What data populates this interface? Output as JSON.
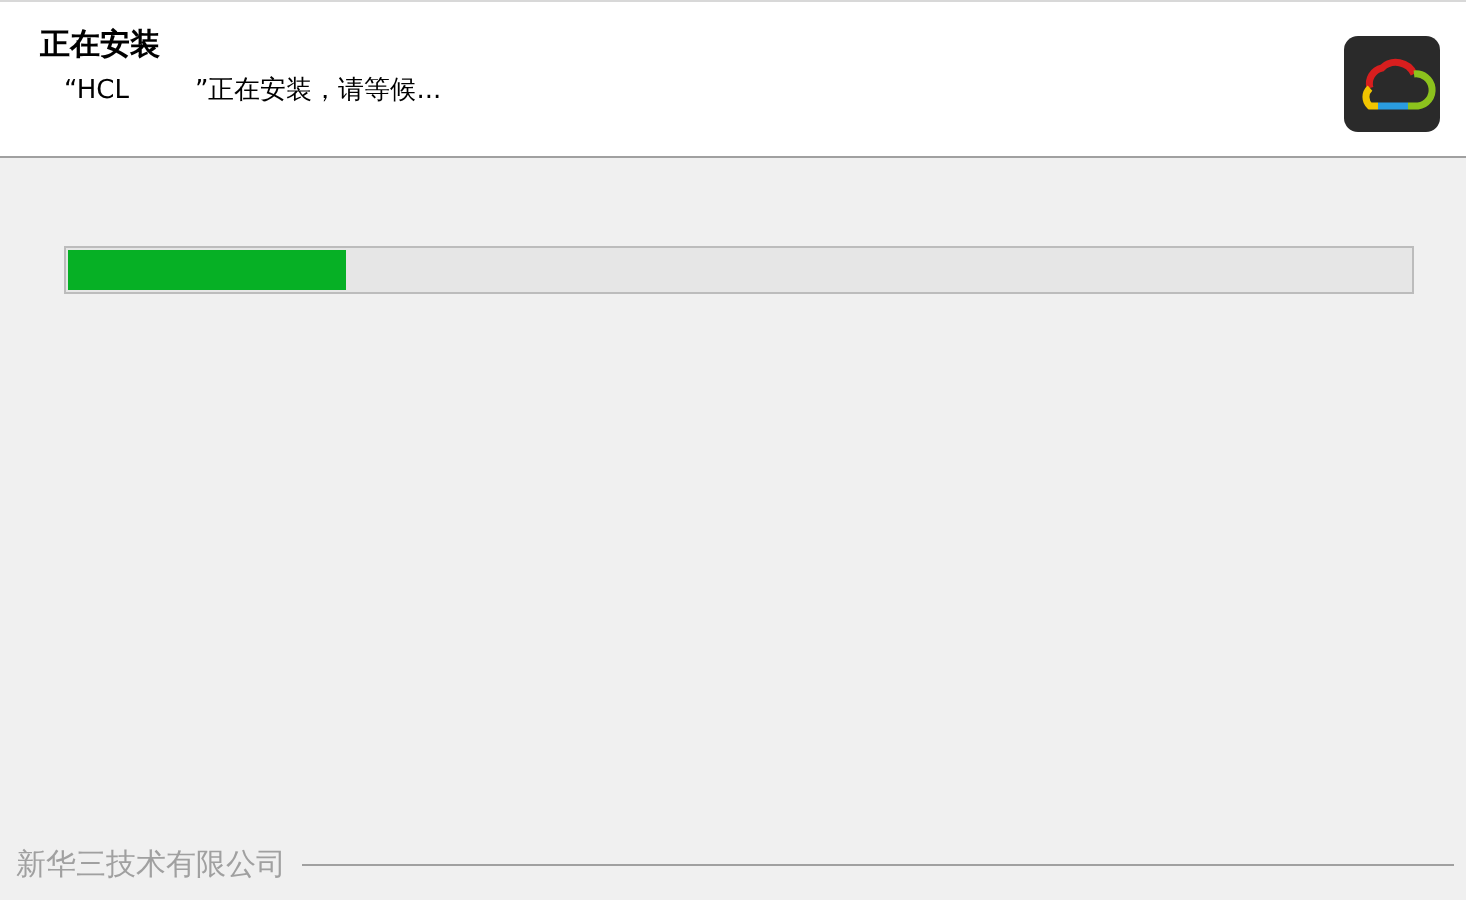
{
  "header": {
    "title": "正在安装",
    "subtitle": "“HCL        ”正在安装，请等候..."
  },
  "progress": {
    "level": 0.207
  },
  "footer": {
    "brand": "新华三技术有限公司"
  }
}
